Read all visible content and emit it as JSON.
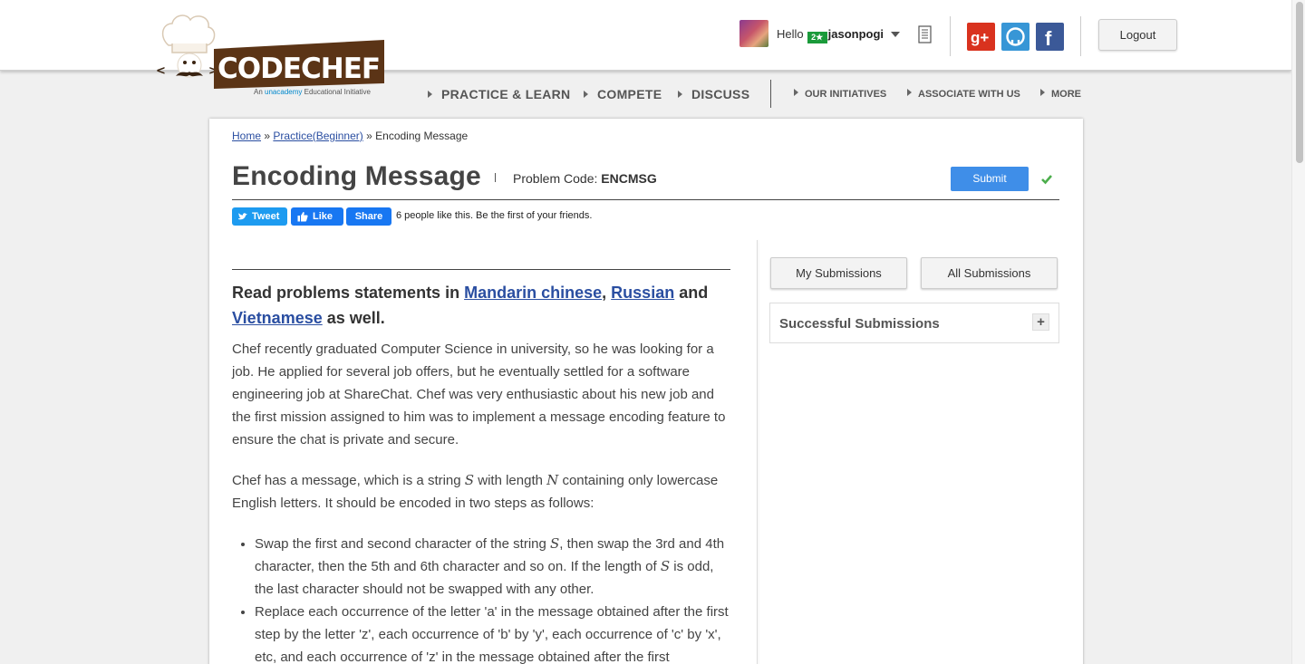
{
  "header": {
    "logo_text": "CODECHEF",
    "tagline_prefix": "An",
    "tagline_brand": "unacademy",
    "tagline_suffix": "Educational Initiative",
    "greeting": "Hello",
    "rating_badge": "2★",
    "username": "jasonpogi",
    "logout_label": "Logout",
    "social_icons": [
      "google-plus-icon",
      "github-icon",
      "facebook-icon"
    ]
  },
  "nav": {
    "primary": [
      "PRACTICE & LEARN",
      "COMPETE",
      "DISCUSS"
    ],
    "secondary": [
      "OUR INITIATIVES",
      "ASSOCIATE WITH US",
      "MORE"
    ]
  },
  "breadcrumb": {
    "home": "Home",
    "sep1": "»",
    "practice": "Practice(Beginner)",
    "sep2": "»",
    "current": "Encoding Message"
  },
  "problem": {
    "title": "Encoding Message",
    "code_label": "Problem Code:",
    "code": "ENCMSG",
    "submit_label": "Submit"
  },
  "share": {
    "tweet": "Tweet",
    "like": "Like",
    "share": "Share",
    "like_text": "6 people like this. Be the first of your friends."
  },
  "statement": {
    "translations_prefix": "Read problems statements in",
    "lang1": "Mandarin chinese",
    "comma": ",",
    "lang2": "Russian",
    "and": "and",
    "lang3": "Vietnamese",
    "translations_suffix": "as well.",
    "para1": "Chef recently graduated Computer Science in university, so he was looking for a job. He applied for several job offers, but he eventually settled for a software engineering job at ShareChat. Chef was very enthusiastic about his new job and the first mission assigned to him was to implement a message encoding feature to ensure the chat is private and secure.",
    "para2_a": "Chef has a message, which is a string",
    "var_s": "S",
    "para2_b": "with length",
    "var_n": "N",
    "para2_c": "containing only lowercase English letters. It should be encoded in two steps as follows:",
    "bullet1_a": "Swap the first and second character of the string",
    "bullet1_b": ", then swap the 3rd and 4th character, then the 5th and 6th character and so on. If the length of",
    "bullet1_c": "is odd, the last character should not be swapped with any other.",
    "bullet2": "Replace each occurrence of the letter 'a' in the message obtained after the first step by the letter 'z', each occurrence of 'b' by 'y', each occurrence of 'c' by 'x', etc, and each occurrence of 'z' in the message obtained after the first"
  },
  "sidebar": {
    "my_submissions": "My Submissions",
    "all_submissions": "All Submissions",
    "successful_submissions": "Successful Submissions",
    "expand": "+"
  }
}
